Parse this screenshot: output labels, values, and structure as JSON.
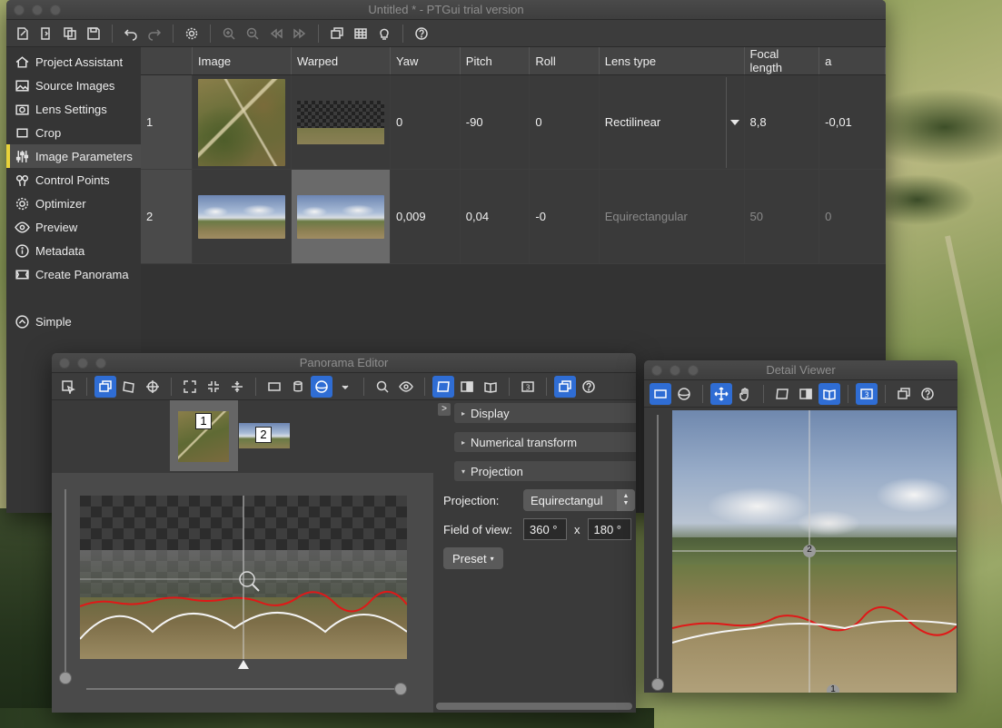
{
  "main_window": {
    "title": "Untitled * - PTGui trial version",
    "sidebar": [
      {
        "label": "Project Assistant",
        "icon": "home-icon"
      },
      {
        "label": "Source Images",
        "icon": "image-icon"
      },
      {
        "label": "Lens Settings",
        "icon": "camera-icon"
      },
      {
        "label": "Crop",
        "icon": "crop-icon"
      },
      {
        "label": "Image Parameters",
        "icon": "sliders-icon",
        "selected": true
      },
      {
        "label": "Control Points",
        "icon": "pin-icon"
      },
      {
        "label": "Optimizer",
        "icon": "gear-icon"
      },
      {
        "label": "Preview",
        "icon": "eye-icon"
      },
      {
        "label": "Metadata",
        "icon": "info-icon"
      },
      {
        "label": "Create Panorama",
        "icon": "panorama-icon"
      }
    ],
    "mode_toggle": "Simple",
    "table": {
      "columns": [
        "",
        "Image",
        "Warped",
        "Yaw",
        "Pitch",
        "Roll",
        "Lens type",
        "Focal length",
        "a"
      ],
      "rows": [
        {
          "num": "1",
          "yaw": "0",
          "pitch": "-90",
          "roll": "0",
          "lens": "Rectilinear",
          "focal": "8,8",
          "a": "-0,01"
        },
        {
          "num": "2",
          "yaw": "0,009",
          "pitch": "0,04",
          "roll": "-0",
          "lens": "Equirectangular",
          "focal": "50",
          "a": "0"
        }
      ]
    }
  },
  "panorama_editor": {
    "title": "Panorama Editor",
    "strip": [
      "1",
      "2"
    ],
    "sections": {
      "display": "Display",
      "numerical": "Numerical transform",
      "projection": "Projection"
    },
    "projection_label": "Projection:",
    "projection_value": "Equirectangul",
    "fov_label": "Field of view:",
    "fov_h": "360 °",
    "fov_x": "x",
    "fov_v": "180 °",
    "preset": "Preset",
    "chevron": ">",
    "help": "?"
  },
  "detail_viewer": {
    "title": "Detail Viewer",
    "marker_2": "2",
    "marker_1": "1",
    "badge": "3"
  },
  "colors": {
    "accent": "#2f6dd4",
    "selection_bar": "#e8d23a",
    "seam_red": "#e01818",
    "seam_white": "#f4f4f4"
  }
}
